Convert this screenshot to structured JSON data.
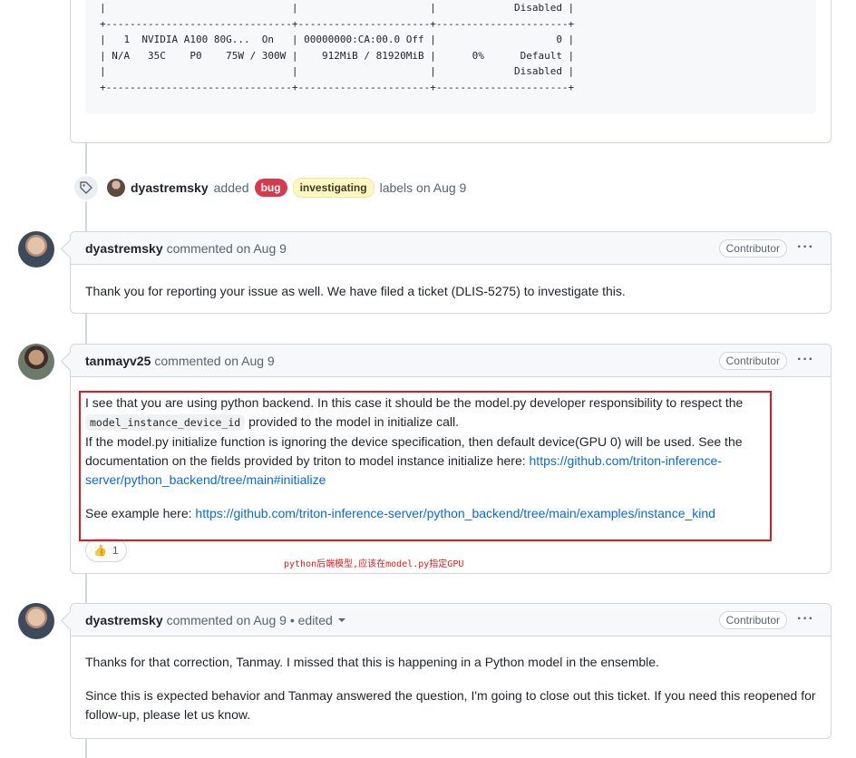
{
  "code_block": {
    "lines": [
      "|                               |                      |             Disabled |",
      "+-------------------------------+----------------------+----------------------+",
      "|   1  NVIDIA A100 80G...  On   | 00000000:CA:00.0 Off |                    0 |",
      "| N/A   35C    P0    75W / 300W |    912MiB / 81920MiB |      0%      Default |",
      "|                               |                      |             Disabled |",
      "+-------------------------------+----------------------+----------------------+"
    ]
  },
  "label_event": {
    "author": "dyastremsky",
    "action": "added",
    "labels": [
      {
        "name": "bug",
        "color": "#d73a4a"
      },
      {
        "name": "investigating",
        "color": "#fff8c5"
      }
    ],
    "suffix": "labels on Aug 9",
    "icon": "tag-icon"
  },
  "comments": [
    {
      "author": "dyastremsky",
      "meta": "commented on Aug 9",
      "badge": "Contributor",
      "body": "Thank you for reporting your issue as well. We have filed a ticket (DLIS-5275) to investigate this."
    },
    {
      "author": "tanmayv25",
      "meta": "commented on Aug 9",
      "badge": "Contributor",
      "p1_a": "I see that you are using python backend. In this case it should be the model.py developer responsibility to respect the",
      "p1_code": "model_instance_device_id",
      "p1_b": "provided to the model in initialize call.",
      "p1_c": "If the model.py initialize function is ignoring the device specification, then default device(GPU 0) will be used. See the documentation on the fields provided by triton to model instance initialize here:",
      "p1_link": "https://github.com/triton-inference-server/python_backend/tree/main#initialize",
      "p2_a": "See example here:",
      "p2_link": "https://github.com/triton-inference-server/python_backend/tree/main/examples/instance_kind",
      "reaction_emoji": "👍",
      "reaction_count": "1"
    },
    {
      "author": "dyastremsky",
      "meta": "commented on Aug 9 • edited",
      "badge": "Contributor",
      "p1": "Thanks for that correction, Tanmay. I missed that this is happening in a Python model in the ensemble.",
      "p2": "Since this is expected behavior and Tanmay answered the question, I'm going to close out this ticket. If you need this reopened for follow-up, please let us know."
    }
  ],
  "annotation": "python后端模型,应该在model.py指定GPU",
  "kebab": "···",
  "colors": {
    "link": "#0969da",
    "highlight": "#e01b1b",
    "border": "#d0d7de"
  }
}
